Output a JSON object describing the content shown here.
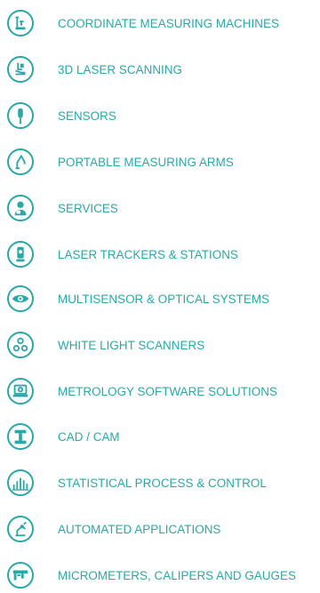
{
  "theme": {
    "accent": "#2aa8a7"
  },
  "menu": {
    "items": [
      {
        "label": "COORDINATE MEASURING MACHINES",
        "icon": "cmm-icon"
      },
      {
        "label": "3D LASER SCANNING",
        "icon": "laser-scanner-hand-icon"
      },
      {
        "label": "SENSORS",
        "icon": "sensor-probe-icon"
      },
      {
        "label": "PORTABLE MEASURING ARMS",
        "icon": "measuring-arm-icon"
      },
      {
        "label": "SERVICES",
        "icon": "service-person-icon"
      },
      {
        "label": "LASER TRACKERS & STATIONS",
        "icon": "laser-tracker-icon"
      },
      {
        "label": "MULTISENSOR & OPTICAL SYSTEMS",
        "icon": "eye-icon"
      },
      {
        "label": "WHITE LIGHT SCANNERS",
        "icon": "three-circles-icon"
      },
      {
        "label": "METROLOGY SOFTWARE SOLUTIONS",
        "icon": "laptop-gear-icon"
      },
      {
        "label": "CAD / CAM",
        "icon": "cad-cam-icon"
      },
      {
        "label": "STATISTICAL PROCESS & CONTROL",
        "icon": "bar-chart-icon"
      },
      {
        "label": "AUTOMATED APPLICATIONS",
        "icon": "robot-arm-icon"
      },
      {
        "label": "MICROMETERS, CALIPERS AND GAUGES",
        "icon": "caliper-icon"
      }
    ]
  }
}
